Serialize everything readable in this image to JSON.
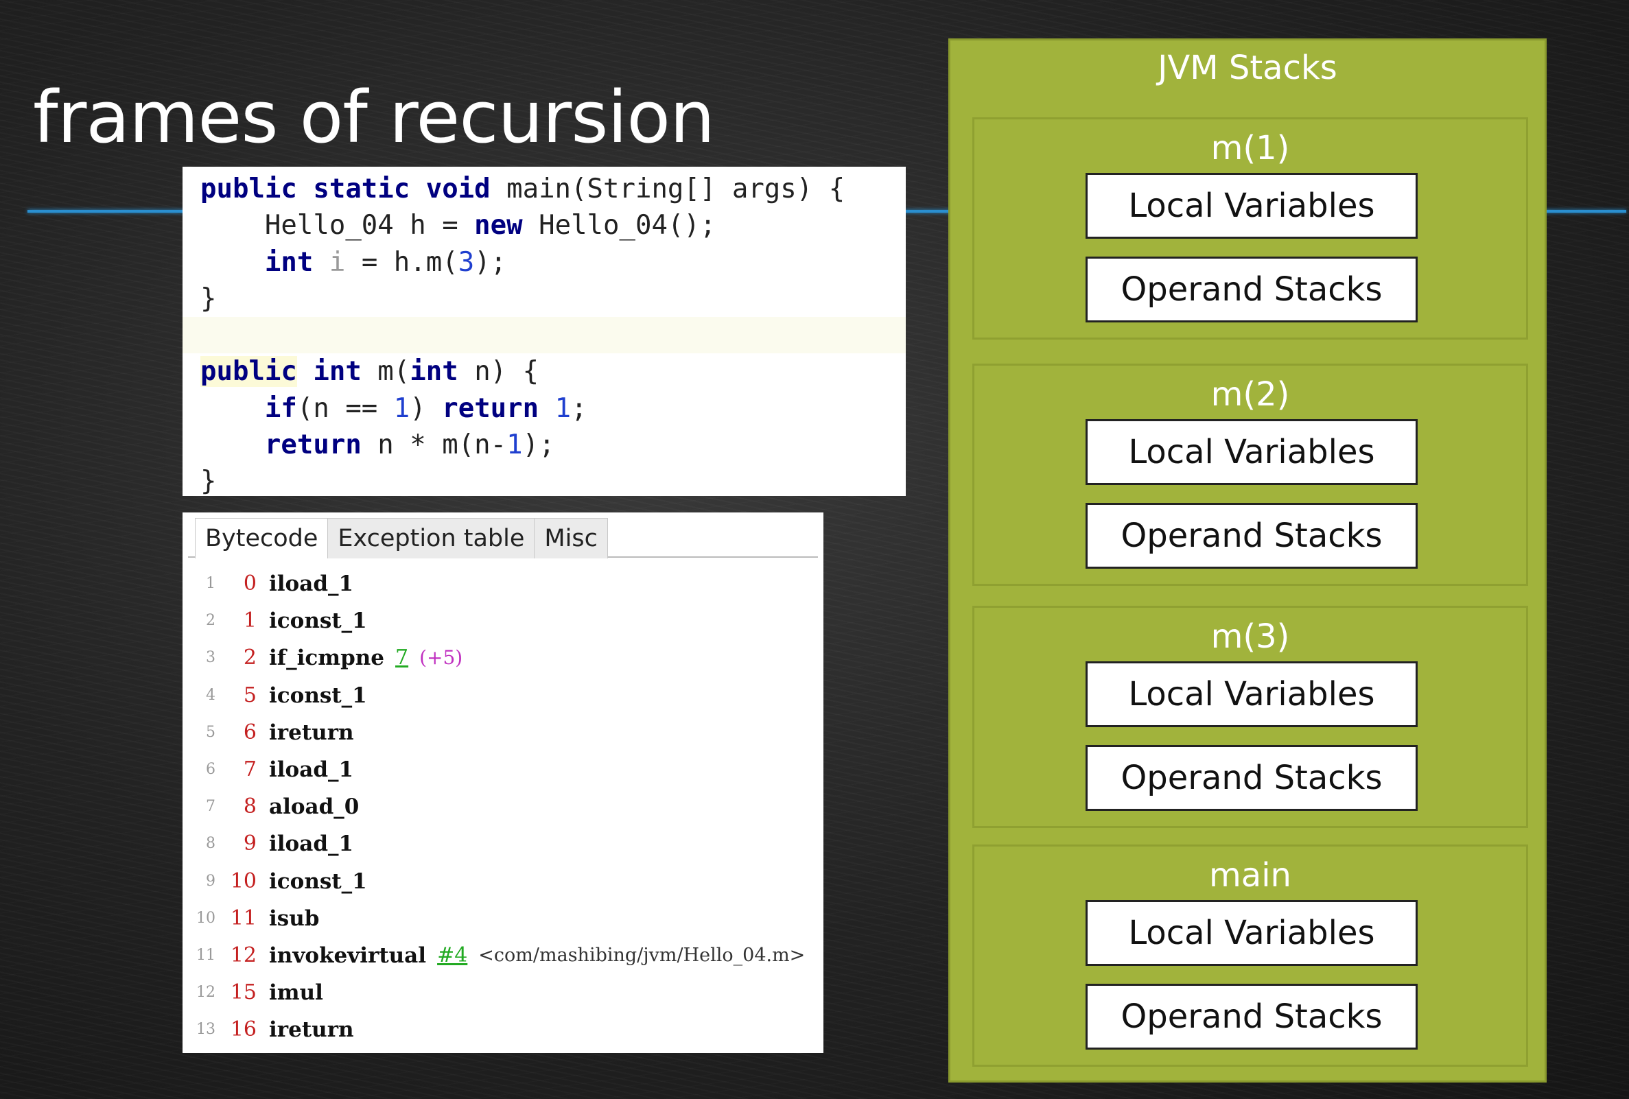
{
  "slide": {
    "title": "frames of recursion"
  },
  "code": {
    "lines": [
      [
        {
          "t": "public static void",
          "c": "kw"
        },
        {
          "t": " main(String[] args) {"
        }
      ],
      [
        {
          "t": "    Hello_04 h = "
        },
        {
          "t": "new",
          "c": "kw"
        },
        {
          "t": " Hello_04();"
        }
      ],
      [
        {
          "t": "    "
        },
        {
          "t": "int",
          "c": "kw"
        },
        {
          "t": " "
        },
        {
          "t": "i",
          "c": "dim"
        },
        {
          "t": " = h.m("
        },
        {
          "t": "3",
          "c": "num"
        },
        {
          "t": ");"
        }
      ],
      [
        {
          "t": "}"
        }
      ],
      [
        {
          "t": ""
        }
      ],
      [
        {
          "t": "public",
          "c": "kw pub-hl"
        },
        {
          "t": " "
        },
        {
          "t": "int",
          "c": "kw"
        },
        {
          "t": " m("
        },
        {
          "t": "int",
          "c": "kw"
        },
        {
          "t": " n) {"
        }
      ],
      [
        {
          "t": "    "
        },
        {
          "t": "if",
          "c": "kw"
        },
        {
          "t": "(n == "
        },
        {
          "t": "1",
          "c": "num"
        },
        {
          "t": ") "
        },
        {
          "t": "return",
          "c": "kw"
        },
        {
          "t": " "
        },
        {
          "t": "1",
          "c": "num"
        },
        {
          "t": ";"
        }
      ],
      [
        {
          "t": "    "
        },
        {
          "t": "return",
          "c": "kw"
        },
        {
          "t": " n * m(n-"
        },
        {
          "t": "1",
          "c": "num"
        },
        {
          "t": ");"
        }
      ],
      [
        {
          "t": "}"
        }
      ]
    ]
  },
  "bytecode": {
    "tabs": [
      "Bytecode",
      "Exception table",
      "Misc"
    ],
    "active_tab": "Bytecode",
    "rows": [
      {
        "no": "1",
        "off": "0",
        "op": "iload_1"
      },
      {
        "no": "2",
        "off": "1",
        "op": "iconst_1"
      },
      {
        "no": "3",
        "off": "2",
        "op": "if_icmpne",
        "arg": "7",
        "extra": "(+5)"
      },
      {
        "no": "4",
        "off": "5",
        "op": "iconst_1"
      },
      {
        "no": "5",
        "off": "6",
        "op": "ireturn"
      },
      {
        "no": "6",
        "off": "7",
        "op": "iload_1"
      },
      {
        "no": "7",
        "off": "8",
        "op": "aload_0"
      },
      {
        "no": "8",
        "off": "9",
        "op": "iload_1"
      },
      {
        "no": "9",
        "off": "10",
        "op": "iconst_1"
      },
      {
        "no": "10",
        "off": "11",
        "op": "isub"
      },
      {
        "no": "11",
        "off": "12",
        "op": "invokevirtual",
        "arg": "#4",
        "ref": "<com/mashibing/jvm/Hello_04.m>"
      },
      {
        "no": "12",
        "off": "15",
        "op": "imul"
      },
      {
        "no": "13",
        "off": "16",
        "op": "ireturn"
      }
    ]
  },
  "jvm_stacks": {
    "title": "JVM Stacks",
    "frames": [
      {
        "name": "m(1)",
        "local": "Local Variables",
        "operand": "Operand Stacks"
      },
      {
        "name": "m(2)",
        "local": "Local Variables",
        "operand": "Operand Stacks"
      },
      {
        "name": "m(3)",
        "local": "Local Variables",
        "operand": "Operand Stacks"
      },
      {
        "name": "main",
        "local": "Local Variables",
        "operand": "Operand Stacks"
      }
    ]
  },
  "colors": {
    "panel_green": "#a1b33c",
    "accent_blue": "#2a8fd0",
    "keyword": "#000080",
    "offset_red": "#c42020"
  }
}
